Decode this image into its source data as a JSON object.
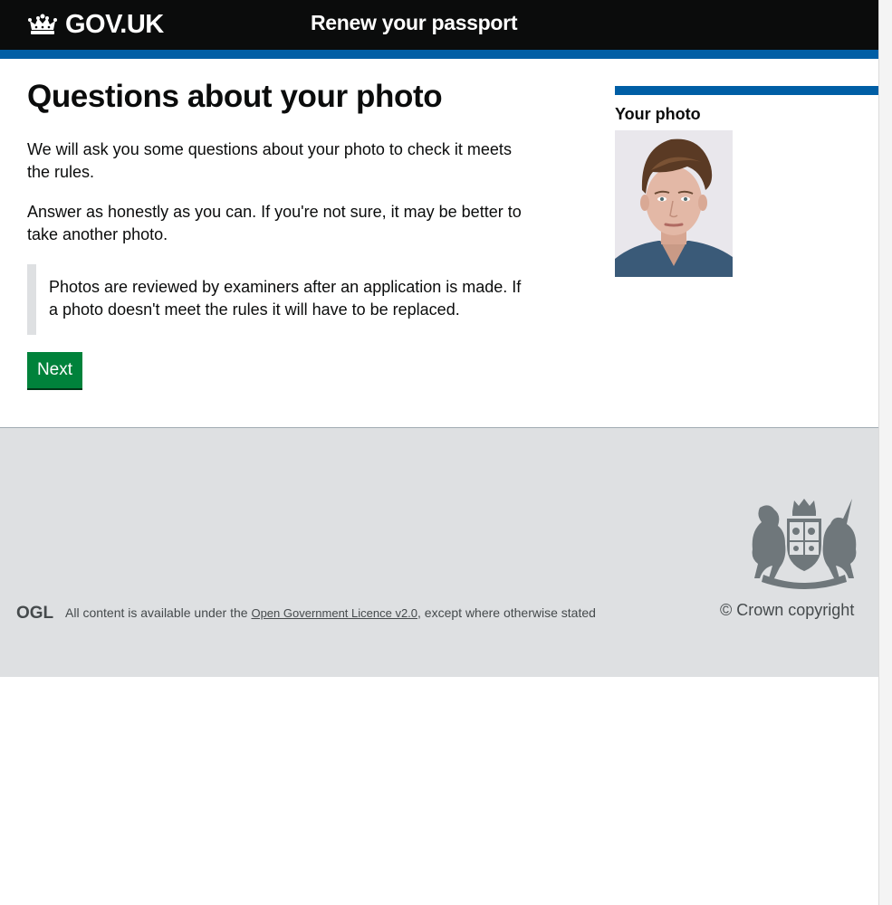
{
  "header": {
    "logo_text": "GOV.UK",
    "service_name": "Renew your passport"
  },
  "main": {
    "title": "Questions about your photo",
    "paragraph_1": "We will ask you some questions about your photo to check it meets the rules.",
    "paragraph_2": "Answer as honestly as you can. If you're not sure, it may be better to take another photo.",
    "notice": "Photos are reviewed by examiners after an application is made. If a photo doesn't meet the rules it will have to be replaced.",
    "next_button_label": "Next"
  },
  "sidebar": {
    "title": "Your photo",
    "photo_alt": "Your photo"
  },
  "footer": {
    "ogl_label": "OGL",
    "licence_prefix": "All content is available under the ",
    "licence_link": "Open Government Licence v2.0",
    "licence_suffix": ", except where otherwise stated",
    "copyright": "© Crown copyright"
  },
  "colors": {
    "header_bg": "#0b0c0c",
    "brand_blue": "#005ea5",
    "button_green": "#00823b",
    "footer_bg": "#dee0e2",
    "inset_border": "#dee0e2"
  },
  "icons": {
    "logo": "crown-icon",
    "footer_licence": "ogl-icon",
    "footer_crest": "royal-coat-of-arms-icon"
  }
}
